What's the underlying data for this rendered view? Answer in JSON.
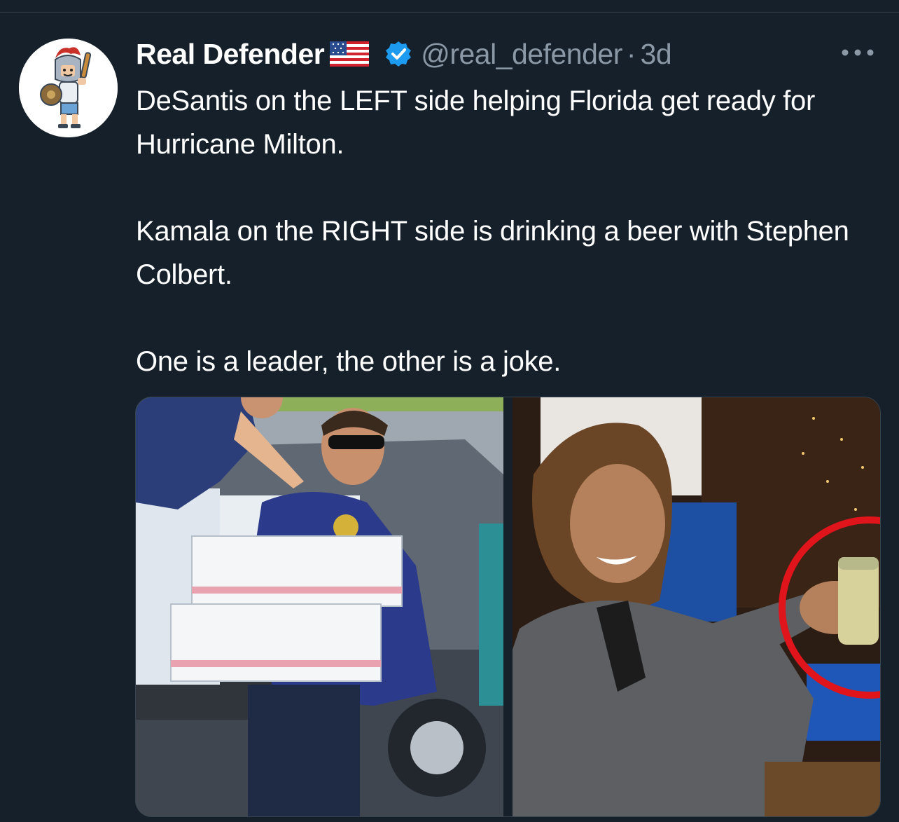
{
  "tweet": {
    "author": {
      "display_name": "Real Defender",
      "handle": "@real_defender",
      "verified": true,
      "flag_icon": "us-flag-icon",
      "avatar_icon": "spartan-warrior-cartoon-avatar"
    },
    "separator": "·",
    "time": "3d",
    "text_lines": [
      "DeSantis on the LEFT side helping Florida get ready for Hurricane Milton.",
      "Kamala on the RIGHT side is drinking a beer with Stephen Colbert.",
      "One is a leader, the other is a joke."
    ],
    "media": [
      {
        "icon": "photo-man-carrying-boxes"
      },
      {
        "icon": "photo-woman-holding-can"
      }
    ]
  },
  "colors": {
    "background": "#15202b",
    "text": "#ffffff",
    "secondary": "#8b98a5",
    "verified": "#1d9bf0",
    "highlight_circle": "#e0141b"
  }
}
